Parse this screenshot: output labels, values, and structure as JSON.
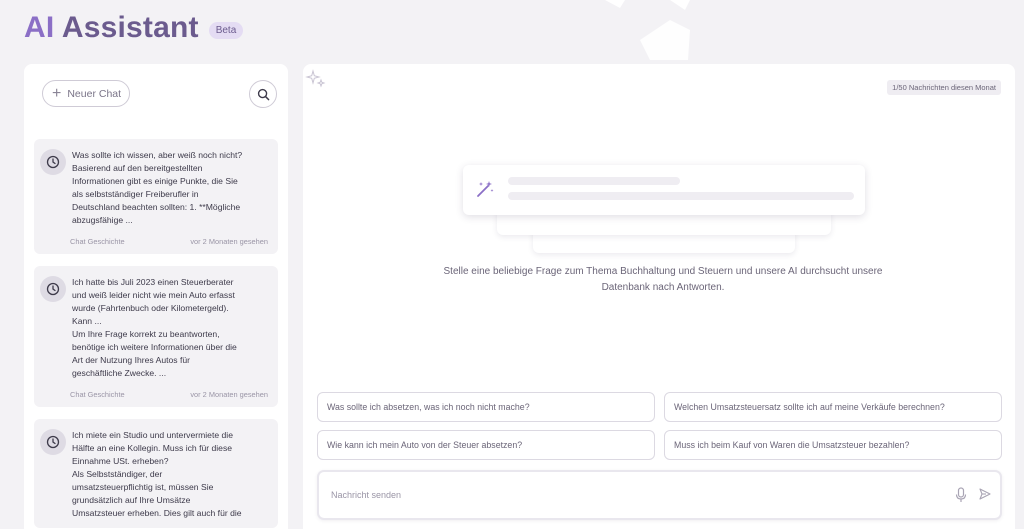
{
  "header": {
    "title_ai": "AI",
    "title_rest": "Assistant",
    "badge": "Beta"
  },
  "sidebar": {
    "new_chat_label": "Neuer Chat",
    "search_icon": "search-icon",
    "history": [
      {
        "title": "Was sollte ich wissen, aber weiß noch nicht?",
        "lines": [
          "Basierend auf den bereitgestellten",
          "Informationen gibt es einige Punkte, die Sie",
          "als selbstständiger Freiberufler in",
          "Deutschland beachten sollten: 1. **Mögliche",
          "abzugsfähige ..."
        ],
        "category": "Chat Geschichte",
        "seen": "vor 2 Monaten gesehen"
      },
      {
        "title_lines": [
          "Ich hatte bis Juli 2023 einen Steuerberater",
          "und weiß leider nicht wie mein Auto erfasst",
          "wurde (Fahrtenbuch oder Kilometergeld).",
          "Kann ..."
        ],
        "lines": [
          "Um Ihre Frage korrekt zu beantworten,",
          "benötige ich weitere Informationen über die",
          "Art der Nutzung Ihres Autos für",
          "geschäftliche Zwecke. ..."
        ],
        "category": "Chat Geschichte",
        "seen": "vor 2 Monaten gesehen"
      },
      {
        "title_lines": [
          "Ich miete ein Studio und untervermiete die",
          "Hälfte an eine Kollegin. Muss ich für diese",
          "Einnahme USt. erheben?"
        ],
        "lines": [
          "Als Selbstständiger, der",
          "umsatzsteuerpflichtig ist, müssen Sie",
          "grundsätzlich auf Ihre Umsätze",
          "Umsatzsteuer erheben. Dies gilt auch für die"
        ]
      }
    ]
  },
  "main": {
    "quota": "1/50 Nachrichten diesen Monat",
    "intro_line1": "Stelle eine beliebige Frage zum Thema Buchhaltung und Steuern und unsere AI durchsucht unsere",
    "intro_line2": "Datenbank nach Antworten.",
    "suggestions": [
      "Was sollte ich absetzen, was ich noch nicht mache?",
      "Welchen Umsatzsteuersatz sollte ich auf meine Verkäufe berechnen?",
      "Wie kann ich mein Auto von der Steuer absetzen?",
      "Muss ich beim Kauf von Waren die Umsatzsteuer bezahlen?"
    ],
    "composer_placeholder": "Nachricht senden"
  },
  "colors": {
    "accent": "#8b6fc6",
    "title": "#6b5b8e",
    "background": "#f3f2f5"
  }
}
